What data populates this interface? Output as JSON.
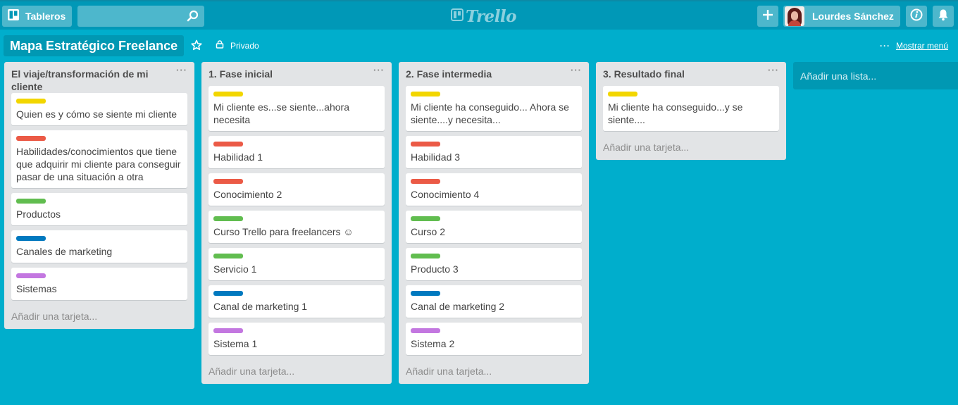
{
  "header": {
    "boards_label": "Tableros",
    "search_value": "",
    "logo_text": "Trello",
    "user_name": "Lourdes Sánchez"
  },
  "board": {
    "title": "Mapa Estratégico Freelance",
    "visibility": "Privado",
    "menu_label": "Mostrar menú"
  },
  "colors": {
    "yellow": "#f2d600",
    "red": "#eb5a46",
    "green": "#61bd4f",
    "blue": "#0079bf",
    "purple": "#c377e0",
    "background": "#00aecc",
    "header": "#0098b7"
  },
  "lists": [
    {
      "title": "El viaje/transformación de mi cliente",
      "add_card": "Añadir una tarjeta...",
      "cards": [
        {
          "label": "yellow",
          "text": "Quien es y cómo se siente mi cliente"
        },
        {
          "label": "red",
          "text": "Habilidades/conocimientos que tiene que adquirir mi cliente para conseguir pasar de una situación a otra"
        },
        {
          "label": "green",
          "text": "Productos"
        },
        {
          "label": "blue",
          "text": "Canales de marketing"
        },
        {
          "label": "purple",
          "text": "Sistemas"
        }
      ]
    },
    {
      "title": "1. Fase inicial",
      "add_card": "Añadir una tarjeta...",
      "cards": [
        {
          "label": "yellow",
          "text": "Mi cliente es...se siente...ahora necesita"
        },
        {
          "label": "red",
          "text": "Habilidad 1"
        },
        {
          "label": "red",
          "text": "Conocimiento 2"
        },
        {
          "label": "green",
          "text": "Curso Trello para freelancers ☺"
        },
        {
          "label": "green",
          "text": "Servicio 1"
        },
        {
          "label": "blue",
          "text": "Canal de marketing 1"
        },
        {
          "label": "purple",
          "text": "Sistema 1"
        }
      ]
    },
    {
      "title": "2. Fase intermedia",
      "add_card": "Añadir una tarjeta...",
      "cards": [
        {
          "label": "yellow",
          "text": "Mi cliente ha conseguido... Ahora se siente....y necesita..."
        },
        {
          "label": "red",
          "text": "Habilidad 3"
        },
        {
          "label": "red",
          "text": "Conocimiento 4"
        },
        {
          "label": "green",
          "text": "Curso 2"
        },
        {
          "label": "green",
          "text": "Producto 3"
        },
        {
          "label": "blue",
          "text": "Canal de marketing 2"
        },
        {
          "label": "purple",
          "text": "Sistema 2"
        }
      ]
    },
    {
      "title": "3. Resultado final",
      "add_card": "Añadir una tarjeta...",
      "cards": [
        {
          "label": "yellow",
          "text": "Mi cliente ha conseguido...y se siente...."
        }
      ]
    }
  ],
  "add_list": "Añadir una lista..."
}
